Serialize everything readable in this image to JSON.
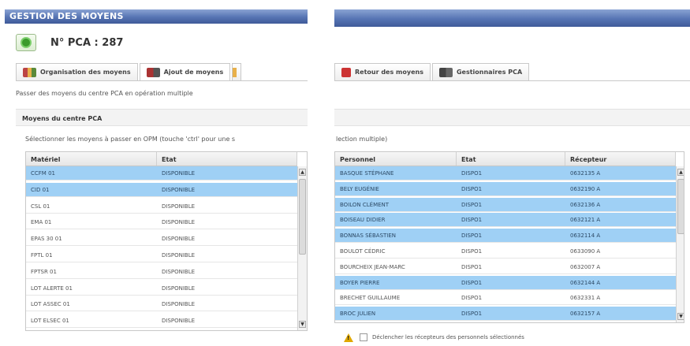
{
  "left": {
    "window_title": "GESTION DES MOYENS",
    "pca_title": "N° PCA : 287",
    "tabs": [
      {
        "label": "Organisation des moyens"
      },
      {
        "label": "Ajout de moyens"
      }
    ],
    "description": "Passer des moyens du centre PCA en opération multiple",
    "section_title": "Moyens du centre PCA",
    "instruction": "Sélectionner les moyens à passer en OPM (touche 'ctrl' pour une s",
    "columns": [
      "Matériel",
      "Etat"
    ],
    "rows": [
      {
        "materiel": "CCFM 01",
        "etat": "DISPONIBLE",
        "selected": true
      },
      {
        "materiel": "CID 01",
        "etat": "DISPONIBLE",
        "selected": true
      },
      {
        "materiel": "CSL 01",
        "etat": "DISPONIBLE",
        "selected": false
      },
      {
        "materiel": "EMA 01",
        "etat": "DISPONIBLE",
        "selected": false
      },
      {
        "materiel": "EPAS 30 01",
        "etat": "DISPONIBLE",
        "selected": false
      },
      {
        "materiel": "FPTL 01",
        "etat": "DISPONIBLE",
        "selected": false
      },
      {
        "materiel": "FPTSR 01",
        "etat": "DISPONIBLE",
        "selected": false
      },
      {
        "materiel": "LOT ALERTE 01",
        "etat": "DISPONIBLE",
        "selected": false
      },
      {
        "materiel": "LOT ASSEC 01",
        "etat": "DISPONIBLE",
        "selected": false
      },
      {
        "materiel": "LOT ELSEC 01",
        "etat": "DISPONIBLE",
        "selected": false
      }
    ]
  },
  "right": {
    "tabs": [
      {
        "label": "Retour des moyens"
      },
      {
        "label": "Gestionnaires PCA"
      }
    ],
    "instruction": "lection multiple)",
    "columns": [
      "Personnel",
      "Etat",
      "Récepteur"
    ],
    "rows": [
      {
        "personnel": "BASQUE STÉPHANE",
        "etat": "DISPO1",
        "recepteur": "0632135 A",
        "selected": true
      },
      {
        "personnel": "BELY EUGÉNIE",
        "etat": "DISPO1",
        "recepteur": "0632190 A",
        "selected": true
      },
      {
        "personnel": "BOILON CLÉMENT",
        "etat": "DISPO1",
        "recepteur": "0632136 A",
        "selected": true
      },
      {
        "personnel": "BOISEAU DIDIER",
        "etat": "DISPO1",
        "recepteur": "0632121 A",
        "selected": true
      },
      {
        "personnel": "BONNAS SÉBASTIEN",
        "etat": "DISPO1",
        "recepteur": "0632114 A",
        "selected": true
      },
      {
        "personnel": "BOULOT CÉDRIC",
        "etat": "DISPO1",
        "recepteur": "0633090 A",
        "selected": false
      },
      {
        "personnel": "BOURCHEIX JEAN-MARC",
        "etat": "DISPO1",
        "recepteur": "0632007 A",
        "selected": false
      },
      {
        "personnel": "BOYER PIERRE",
        "etat": "DISPO1",
        "recepteur": "0632144 A",
        "selected": true
      },
      {
        "personnel": "BRECHET GUILLAUME",
        "etat": "DISPO1",
        "recepteur": "0632331 A",
        "selected": false
      },
      {
        "personnel": "BROC JULIEN",
        "etat": "DISPO1",
        "recepteur": "0632157 A",
        "selected": true
      }
    ],
    "footer_checkbox_label": "Déclencher les récepteurs des personnels sélectionnés"
  },
  "colors": {
    "titlebar": "#5674b3",
    "selection": "#9fd0f5"
  },
  "icons": {
    "refresh": "refresh-icon",
    "warning": "warning-icon"
  }
}
